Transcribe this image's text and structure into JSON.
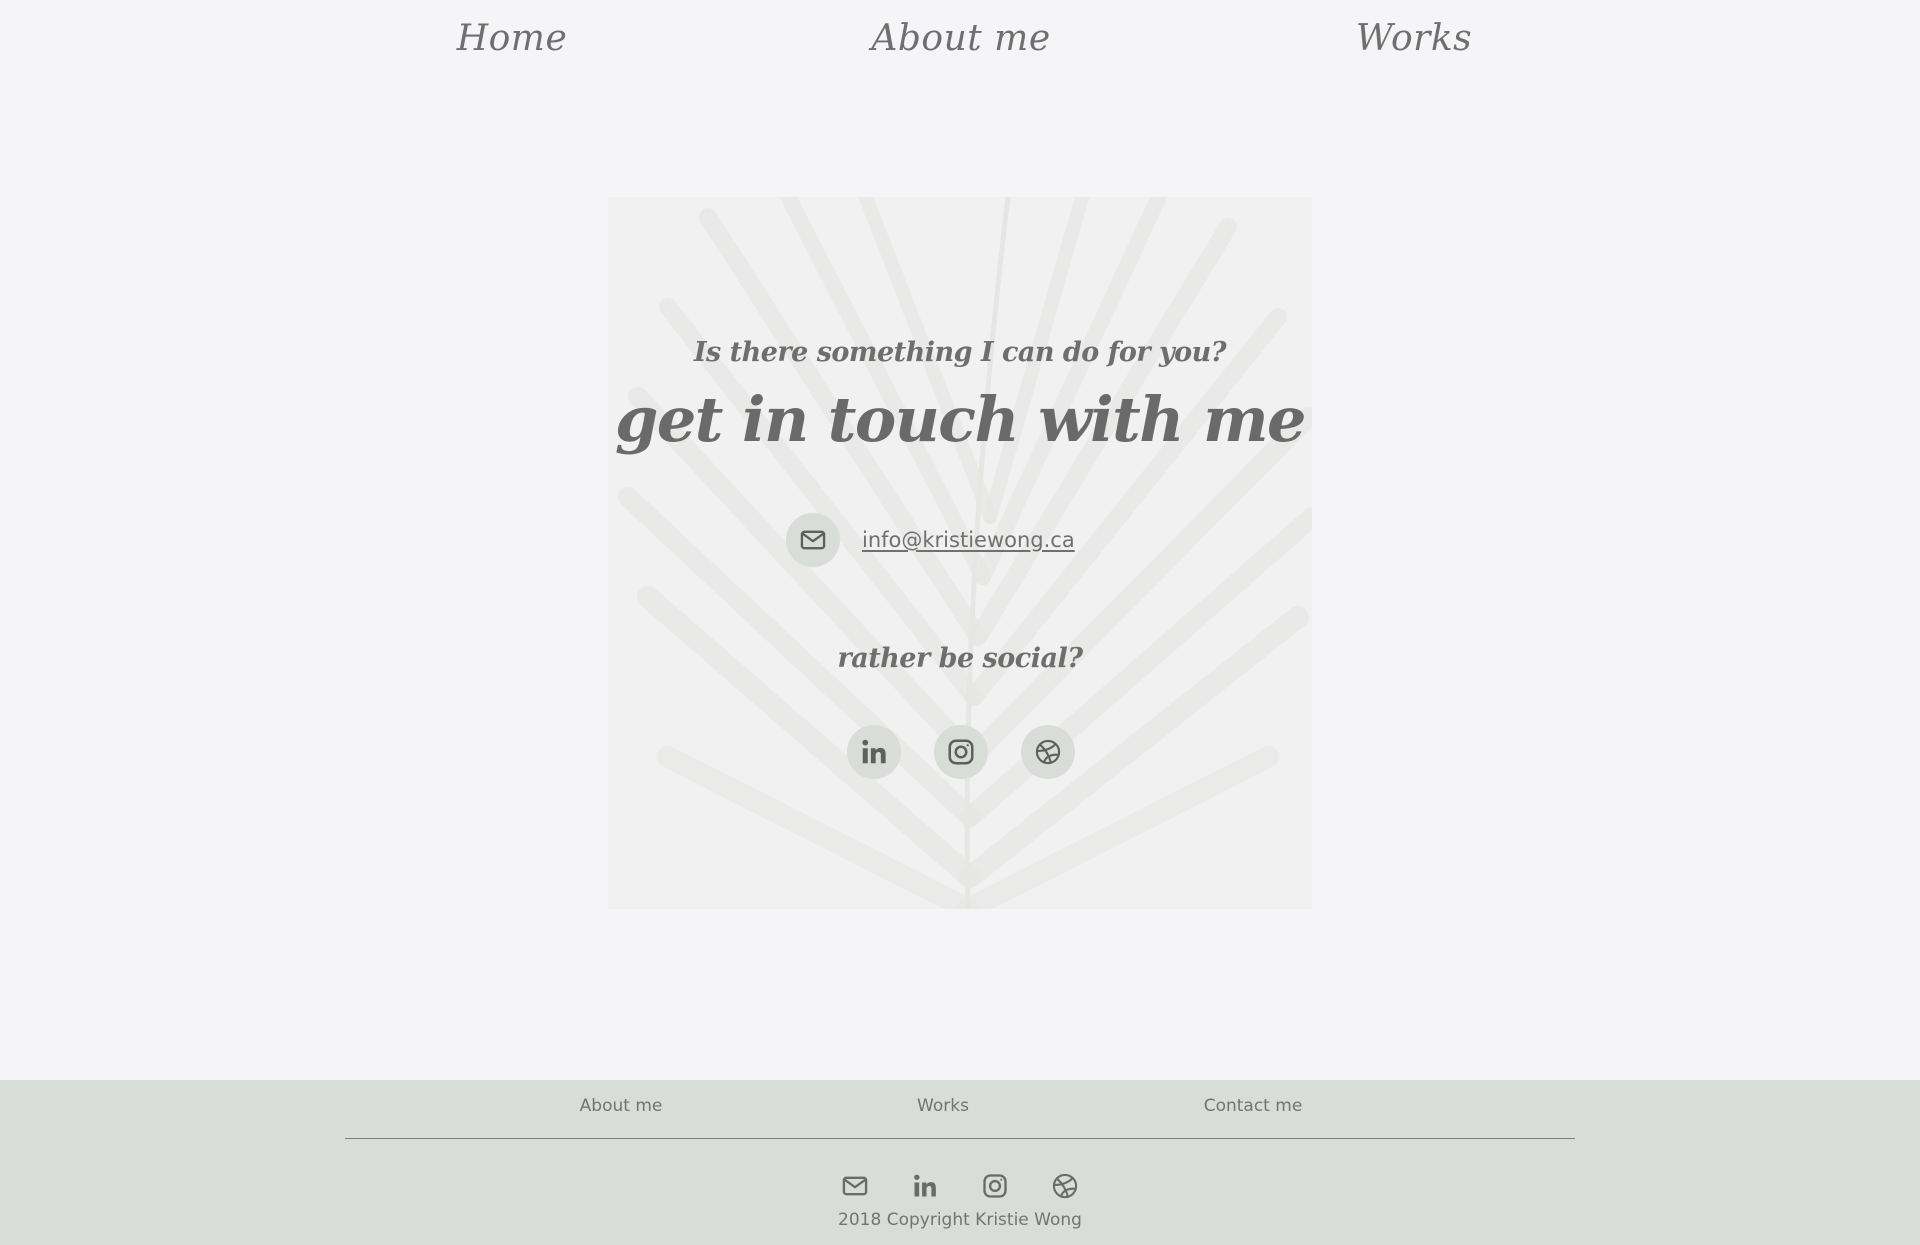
{
  "nav": {
    "home": "Home",
    "about": "About me",
    "works": "Works"
  },
  "contact": {
    "prompt": "Is there something I can do for you?",
    "headline": "get in touch with me",
    "email": "info@kristiewong.ca",
    "email_icon": "envelope-icon",
    "social_prompt": "rather be social?",
    "social_icons": [
      "linkedin-icon",
      "instagram-icon",
      "dribbble-icon"
    ]
  },
  "footer": {
    "links": [
      "About me",
      "Works",
      "Contact me"
    ],
    "icons": [
      "envelope-icon",
      "linkedin-icon",
      "instagram-icon",
      "dribbble-icon"
    ],
    "copyright": "2018 Copyright Kristie Wong"
  },
  "colors": {
    "page_bg": "#f5f5f7",
    "footer_bg": "#d8ddd8",
    "icon_circle": "#d8ddd8",
    "text": "#6b6b6b"
  }
}
